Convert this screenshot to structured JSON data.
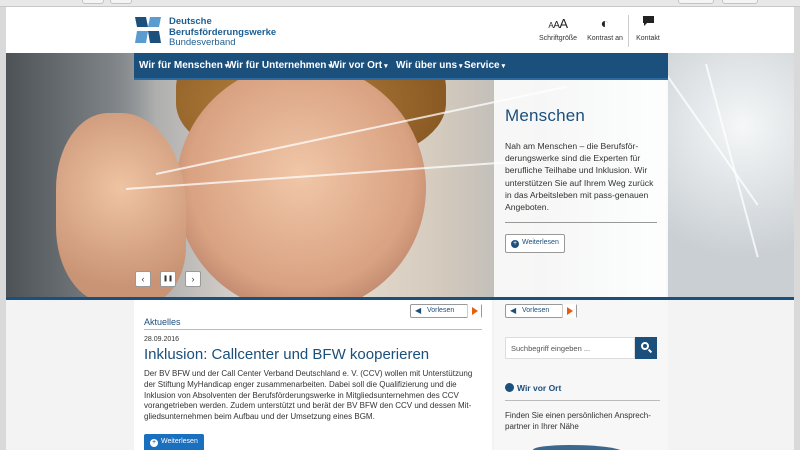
{
  "header": {
    "logo_line1": "Deutsche",
    "logo_line2": "Berufsförderungswerke",
    "logo_line3": "Bundesverband",
    "tools": [
      {
        "icon": "font-size-icon",
        "glyph": "AAA",
        "label": "Schriftgröße"
      },
      {
        "icon": "contrast-icon",
        "glyph": "◐",
        "label": "Kontrast an"
      },
      {
        "icon": "speech-bubble-icon",
        "glyph": "💬",
        "label": "Kontakt"
      }
    ]
  },
  "nav": {
    "items": [
      {
        "label": "Wir für Menschen"
      },
      {
        "label": "Wir für Unternehmen"
      },
      {
        "label": "Wir vor Ort"
      },
      {
        "label": "Wir über uns"
      },
      {
        "label": "Service"
      }
    ],
    "caret": "▾"
  },
  "hero": {
    "title": "Menschen",
    "text": "Nah am Menschen – die Berufsför-derungswerke sind die Experten für berufliche Teilhabe und Inklusion. Wir unterstützen Sie auf Ihrem Weg zurück in das Arbeitsleben mit pass-genauen Angeboten.",
    "button": "Weiterlesen",
    "controls": {
      "prev": "‹",
      "pause": "❚❚",
      "next": "›"
    }
  },
  "news": {
    "section_label": "Aktuelles",
    "readaloud": "Vorlesen",
    "date": "28.09.2016",
    "headline": "Inklusion: Callcenter und BFW kooperieren",
    "body": "Der BV BFW und der Call Center Verband Deutschland e. V. (CCV) wollen mit Unterstützung der Stiftung MyHandicap enger zusammenarbeiten. Dabei soll die Qualifizierung und die Inklusion von Absolventen der Berufsförderungswerke in Mitgliedsunternehmen des CCV vorangetrieben werden. Zudem unterstützt und berät der BV BFW den CCV und dessen Mit-gliedsunternehmen beim Aufbau und der Umsetzung eines BGM.",
    "button": "Weiterlesen"
  },
  "sidebar": {
    "readaloud": "Vorlesen",
    "search_placeholder": "Suchbegriff eingeben ...",
    "section_title": "Wir vor Ort",
    "section_text": "Finden Sie einen persönlichen Ansprech-partner in Ihrer Nähe"
  },
  "colors": {
    "brand": "#1b4f7c",
    "accent": "#e85c0d",
    "button": "#1b6fbf"
  }
}
